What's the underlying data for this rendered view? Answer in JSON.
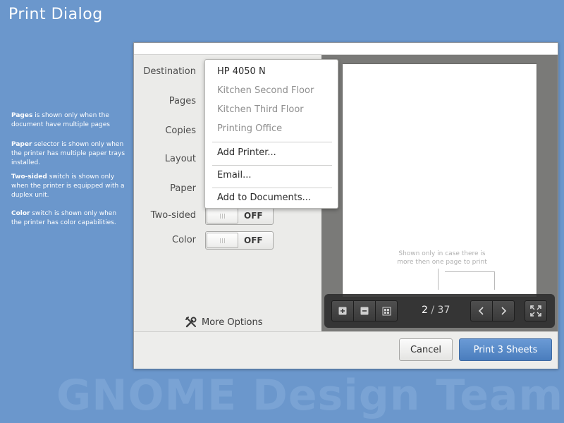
{
  "page": {
    "title": "Print Dialog",
    "watermark": "GNOME Design Team"
  },
  "notes": [
    {
      "bold": "Pages",
      "text": " is shown only when the document have multiple pages"
    },
    {
      "bold": "Paper",
      "text": " selector is shown only when the printer has multiple paper trays installed."
    },
    {
      "bold": "Two-sided",
      "text": " switch is shown only when the printer is equipped with a duplex unit."
    },
    {
      "bold": "Color",
      "text": " switch is shown only when the printer has color capabilities."
    }
  ],
  "settings": {
    "destination_label": "Destination",
    "pages_label": "Pages",
    "copies_label": "Copies",
    "layout_label": "Layout",
    "paper_label": "Paper",
    "two_sided_label": "Two-sided",
    "two_sided_state": "OFF",
    "color_label": "Color",
    "color_state": "OFF",
    "more_options": "More Options"
  },
  "destination_menu": {
    "selected": "HP 4050 N",
    "printers": [
      "Kitchen Second Floor",
      "Kitchen Third Floor",
      "Printing Office"
    ],
    "add_printer": "Add Printer...",
    "email": "Email...",
    "add_to_documents": "Add to Documents..."
  },
  "preview": {
    "annotation": "Shown only in case there is more then one page to print",
    "current_page": "2",
    "separator": "/",
    "total_pages": "37"
  },
  "footer": {
    "cancel": "Cancel",
    "print": "Print 3 Sheets"
  },
  "icons": {
    "zoom_in": "plus-square-icon",
    "zoom_out": "minus-square-icon",
    "grid": "grid-view-icon",
    "prev": "chevron-left-icon",
    "next": "chevron-right-icon",
    "fullscreen": "fullscreen-icon",
    "more_options": "tools-icon"
  },
  "colors": {
    "background": "#6b97cc",
    "accent": "#4a7dbd"
  }
}
